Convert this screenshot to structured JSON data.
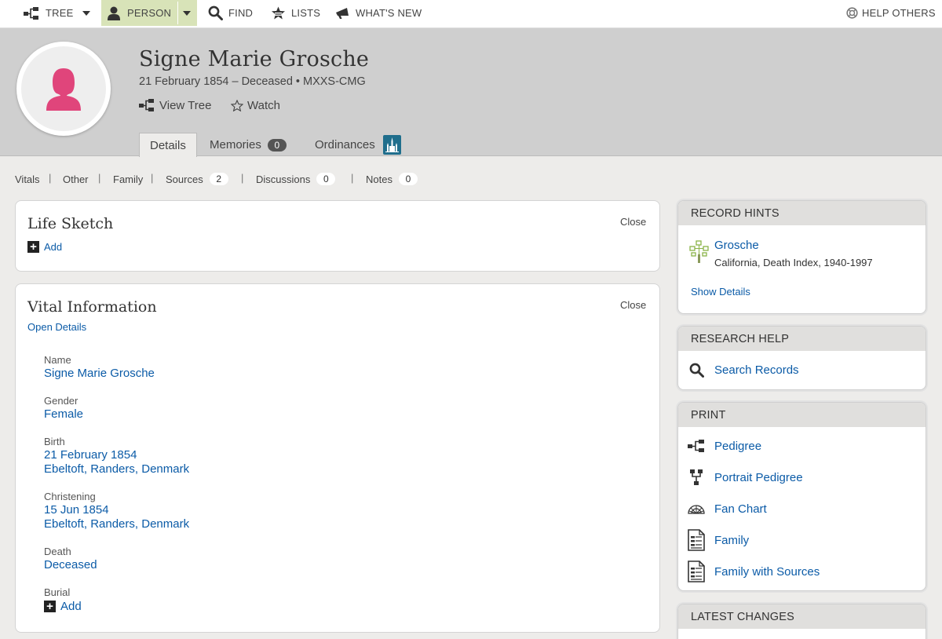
{
  "nav": {
    "tree": "TREE",
    "person": "PERSON",
    "find": "FIND",
    "lists": "LISTS",
    "whats_new": "WHAT'S NEW",
    "help_others": "HELP OTHERS"
  },
  "person": {
    "name": "Signe Marie Grosche",
    "lifespan": "21 February 1854 – Deceased • MXXS-CMG",
    "view_tree": "View Tree",
    "watch": "Watch",
    "avatar_color": "#e0457b"
  },
  "tabs": {
    "details": "Details",
    "memories": "Memories",
    "memories_count": "0",
    "ordinances": "Ordinances"
  },
  "subnav": {
    "vitals": "Vitals",
    "other": "Other",
    "family": "Family",
    "sources": "Sources",
    "sources_count": "2",
    "discussions": "Discussions",
    "discussions_count": "0",
    "notes": "Notes",
    "notes_count": "0",
    "separator": "|"
  },
  "life_sketch": {
    "title": "Life Sketch",
    "close": "Close",
    "add": "Add"
  },
  "vital": {
    "title": "Vital Information",
    "close": "Close",
    "open_details": "Open Details",
    "name_label": "Name",
    "name_value": "Signe Marie Grosche",
    "gender_label": "Gender",
    "gender_value": "Female",
    "birth_label": "Birth",
    "birth_date": "21 February 1854",
    "birth_place": "Ebeltoft, Randers, Denmark",
    "christening_label": "Christening",
    "christening_date": "15 Jun 1854",
    "christening_place": "Ebeltoft, Randers, Denmark",
    "death_label": "Death",
    "death_value": "Deceased",
    "burial_label": "Burial",
    "burial_add": "Add"
  },
  "record_hints": {
    "title": "RECORD HINTS",
    "hint_name": "Grosche",
    "hint_source": "California, Death Index, 1940-1997",
    "show_details": "Show Details"
  },
  "research_help": {
    "title": "RESEARCH HELP",
    "search_records": "Search Records"
  },
  "print": {
    "title": "PRINT",
    "pedigree": "Pedigree",
    "portrait_pedigree": "Portrait Pedigree",
    "fan_chart": "Fan Chart",
    "family": "Family",
    "family_sources": "Family with Sources"
  },
  "latest_changes": {
    "title": "LATEST CHANGES"
  }
}
